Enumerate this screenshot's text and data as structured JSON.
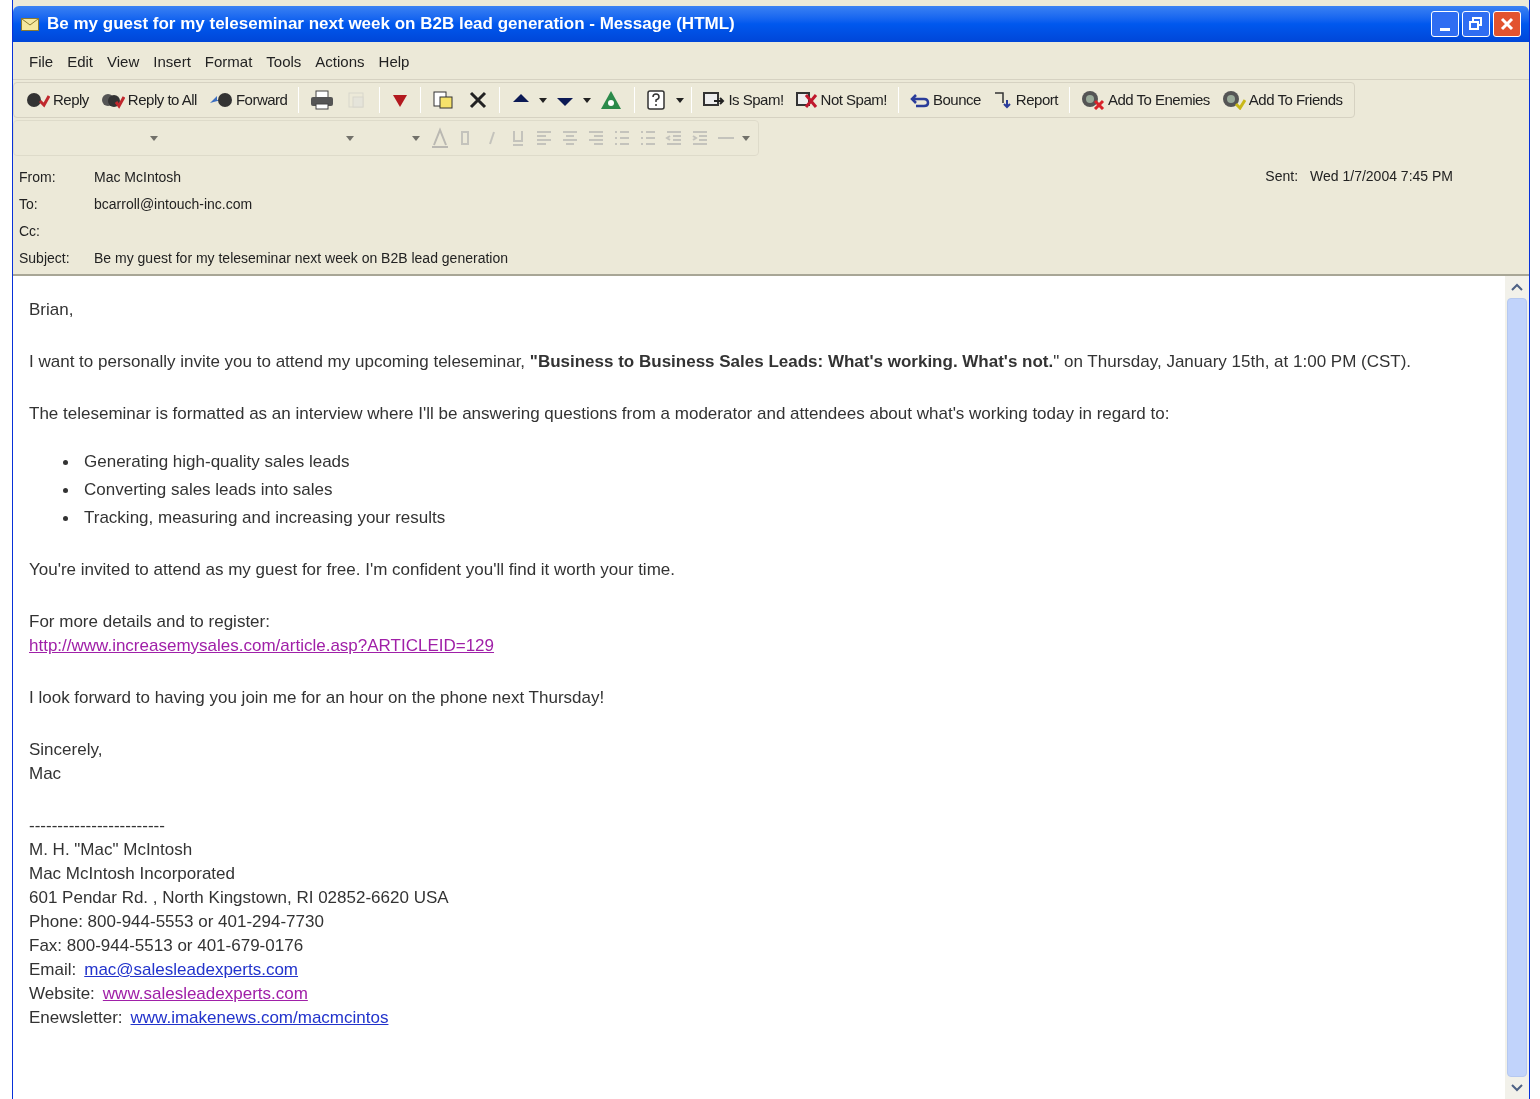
{
  "window": {
    "title": "Be my guest for my teleseminar next week on B2B lead generation - Message (HTML)"
  },
  "menu": [
    "File",
    "Edit",
    "View",
    "Insert",
    "Format",
    "Tools",
    "Actions",
    "Help"
  ],
  "toolbar": [
    {
      "kind": "button",
      "label": "Reply"
    },
    {
      "kind": "button",
      "label": "Reply to All"
    },
    {
      "kind": "button",
      "label": "Forward"
    },
    {
      "kind": "separator"
    },
    {
      "kind": "icon"
    },
    {
      "kind": "icon",
      "disabled": true
    },
    {
      "kind": "separator"
    },
    {
      "kind": "icon"
    },
    {
      "kind": "separator"
    },
    {
      "kind": "icon"
    },
    {
      "kind": "icon"
    },
    {
      "kind": "separator"
    },
    {
      "kind": "icon",
      "dropdown": true
    },
    {
      "kind": "icon",
      "dropdown": true
    },
    {
      "kind": "icon"
    },
    {
      "kind": "separator"
    },
    {
      "kind": "icon",
      "dropdown": true
    },
    {
      "kind": "separator"
    },
    {
      "kind": "button",
      "label": "Is Spam!"
    },
    {
      "kind": "button",
      "label": "Not Spam!"
    },
    {
      "kind": "separator"
    },
    {
      "kind": "button",
      "label": "Bounce"
    },
    {
      "kind": "button",
      "label": "Report"
    },
    {
      "kind": "separator"
    },
    {
      "kind": "button",
      "label": "Add To Enemies"
    },
    {
      "kind": "button",
      "label": "Add To Friends"
    }
  ],
  "format_toolbar": {
    "disabled": true
  },
  "header": {
    "fields": [
      {
        "label": "From:",
        "value": "Mac McIntosh"
      },
      {
        "label": "To:",
        "value": "bcarroll@intouch-inc.com"
      },
      {
        "label": "Cc:"
      },
      {
        "label": "Subject:",
        "value": "Be my guest for my teleseminar next week on B2B lead generation"
      }
    ],
    "sent": {
      "label": "Sent:",
      "value": "Wed 1/7/2004 7:45 PM"
    }
  },
  "body": [
    {
      "kind": "paragraph",
      "text": "Brian,"
    },
    {
      "kind": "paragraph",
      "text": "I want to personally invite you to attend my upcoming teleseminar, **\"Business to Business Sales Leads: What's working. What's not.**\" on Thursday, January 15th, at 1:00 PM (CST)."
    },
    {
      "kind": "paragraph",
      "text": "The teleseminar is formatted as an interview where I'll be answering questions from a moderator and attendees about what's working today in regard to:"
    },
    {
      "kind": "list",
      "items": [
        "Generating high-quality sales leads",
        "Converting sales leads into sales",
        "Tracking, measuring and increasing your results"
      ]
    },
    {
      "kind": "paragraph",
      "text": "You're invited to attend as my guest for free. I'm confident you'll find it worth your time."
    },
    {
      "kind": "lines",
      "lines": [
        {
          "text": "For more details and to register:"
        },
        {
          "link": "http://www.increasemysales.com/article.asp?ARTICLEID=129",
          "visited": true
        }
      ]
    },
    {
      "kind": "paragraph",
      "text": "I look forward to having you join me for an hour on the phone next Thursday!"
    },
    {
      "kind": "lines",
      "lines": [
        {
          "text": "Sincerely,"
        },
        {
          "text": "Mac"
        }
      ]
    },
    {
      "kind": "lines",
      "lines": [
        {
          "text": "------------------------"
        },
        {
          "text": "M. H. \"Mac\" McIntosh"
        },
        {
          "text": "Mac McIntosh Incorporated"
        },
        {
          "text": "601 Pendar Rd. , North Kingstown, RI 02852-6620 USA"
        },
        {
          "text": "Phone: 800-944-5553 or 401-294-7730"
        },
        {
          "text": "Fax: 800-944-5513 or 401-679-0176"
        },
        {
          "text": "Email:",
          "link": "mac@salesleadexperts.com",
          "visited": false
        },
        {
          "text": "Website:",
          "link": "www.salesleadexperts.com",
          "visited": true
        },
        {
          "text": "Enewsletter:",
          "link": "www.imakenews.com/macmcintos",
          "visited": false
        }
      ]
    }
  ]
}
